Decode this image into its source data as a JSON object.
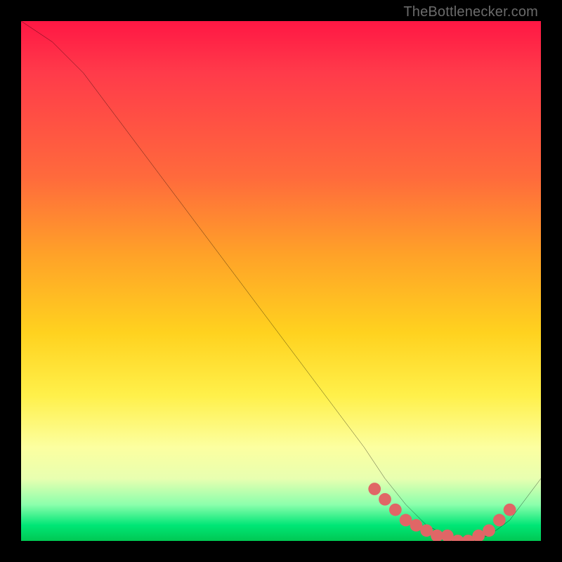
{
  "watermark": "TheBottleneсker.com",
  "chart_data": {
    "type": "line",
    "title": "",
    "xlabel": "",
    "ylabel": "",
    "xlim": [
      0,
      100
    ],
    "ylim": [
      0,
      100
    ],
    "series": [
      {
        "name": "curve",
        "color": "#000000",
        "x": [
          0,
          6,
          12,
          18,
          24,
          30,
          36,
          42,
          48,
          54,
          60,
          66,
          70,
          74,
          78,
          82,
          86,
          90,
          94,
          100
        ],
        "y": [
          100,
          96,
          90,
          82,
          74,
          66,
          58,
          50,
          42,
          34,
          26,
          18,
          12,
          7,
          3,
          1,
          0,
          1,
          4,
          12
        ]
      }
    ],
    "markers": {
      "name": "dots",
      "color": "#e06666",
      "radius": 1.2,
      "x": [
        68,
        70,
        72,
        74,
        76,
        78,
        80,
        82,
        84,
        86,
        88,
        90,
        92,
        94
      ],
      "y": [
        10,
        8,
        6,
        4,
        3,
        2,
        1,
        1,
        0,
        0,
        1,
        2,
        4,
        6
      ]
    }
  }
}
